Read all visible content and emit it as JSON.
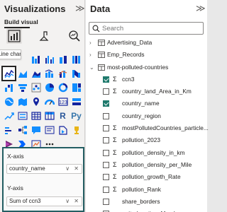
{
  "visualizations": {
    "title": "Visualizations",
    "collapse_glyph": "≫",
    "build_visual_label": "Build visual",
    "tooltip": "Line chart",
    "grid_icons": [
      [
        "line-chart-icon",
        "area-chart-icon",
        "stacked-area-chart-icon",
        "line-and-column-chart-icon",
        "line-and-stacked-column-chart-icon",
        "ribbon-chart-icon"
      ],
      [
        "waterfall-chart-icon",
        "funnel-chart-icon",
        "scatter-chart-icon",
        "pie-chart-icon",
        "donut-chart-icon",
        "treemap-icon"
      ],
      [
        "map-icon",
        "filled-map-icon",
        "azure-map-icon",
        "gauge-icon",
        "card-icon",
        "multi-row-card-icon"
      ],
      [
        "kpi-icon",
        "slicer-icon",
        "table-icon",
        "matrix-icon",
        "r-visual-icon",
        "python-visual-icon"
      ],
      [
        "key-influencers-icon",
        "decomposition-tree-icon",
        "qa-icon",
        "smart-narrative-icon",
        "paginated-report-icon",
        "trophy-icon"
      ],
      [
        "power-apps-icon",
        "power-automate-icon",
        "metrics-icon",
        "more-visuals-icon",
        "",
        ""
      ]
    ],
    "r_label": "R",
    "py_label": "Py",
    "wells": {
      "x_axis_label": "X-axis",
      "x_axis_value": "country_name",
      "y_axis_label": "Y-axis",
      "y_axis_value": "Sum of ccn3",
      "controls": "∨ ✕"
    }
  },
  "data_pane": {
    "title": "Data",
    "collapse_glyph": "≫",
    "search_placeholder": "Search",
    "tables": [
      {
        "name": "Advertising_Data",
        "expanded": false
      },
      {
        "name": "Emp_Records",
        "expanded": false
      },
      {
        "name": "most-polluted-countries",
        "expanded": true
      }
    ],
    "fields": [
      {
        "name": "ccn3",
        "checked": true,
        "sigma": true
      },
      {
        "name": "country_land_Area_in_Km",
        "checked": false,
        "sigma": true
      },
      {
        "name": "country_name",
        "checked": true,
        "sigma": false
      },
      {
        "name": "country_region",
        "checked": false,
        "sigma": false
      },
      {
        "name": "mostPollutedCountries_particle...",
        "checked": false,
        "sigma": true
      },
      {
        "name": "pollution_2023",
        "checked": false,
        "sigma": true
      },
      {
        "name": "pollution_density_in_km",
        "checked": false,
        "sigma": true
      },
      {
        "name": "pollution_density_per_Mile",
        "checked": false,
        "sigma": true
      },
      {
        "name": "pollution_growth_Rate",
        "checked": false,
        "sigma": true
      },
      {
        "name": "pollution_Rank",
        "checked": false,
        "sigma": true
      },
      {
        "name": "share_borders",
        "checked": false,
        "sigma": false
      },
      {
        "name": "united_nation_Member",
        "checked": false,
        "sigma": false
      }
    ]
  },
  "colors": {
    "accent_teal": "#235d62",
    "checkbox_on": "#1f7a6d",
    "pane_bg": "#f3f2f1"
  }
}
